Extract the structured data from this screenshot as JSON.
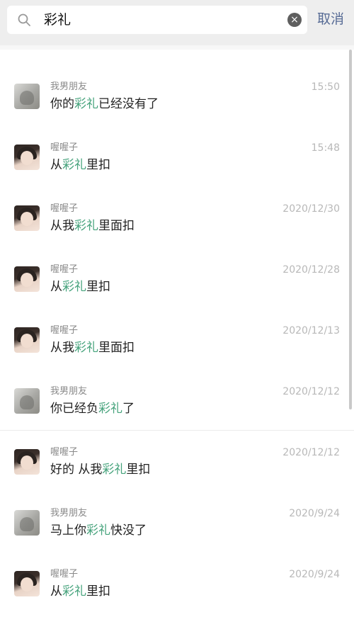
{
  "search": {
    "query": "彩礼",
    "cancel_label": "取消",
    "clear_icon": "×",
    "highlight_color": "#46a37c"
  },
  "results": [
    {
      "sender": "我男朋友",
      "time": "15:50",
      "avatar": "boy",
      "parts": [
        "你的",
        "彩礼",
        "已经没有了"
      ]
    },
    {
      "sender": "喔喔子",
      "time": "15:48",
      "avatar": "girl",
      "parts": [
        "从",
        "彩礼",
        "里扣"
      ]
    },
    {
      "sender": "喔喔子",
      "time": "2020/12/30",
      "avatar": "girl",
      "parts": [
        "从我",
        "彩礼",
        "里面扣"
      ]
    },
    {
      "sender": "喔喔子",
      "time": "2020/12/28",
      "avatar": "girl",
      "parts": [
        "从",
        "彩礼",
        "里扣"
      ]
    },
    {
      "sender": "喔喔子",
      "time": "2020/12/13",
      "avatar": "girl",
      "parts": [
        "从我",
        "彩礼",
        "里面扣"
      ]
    },
    {
      "sender": "我男朋友",
      "time": "2020/12/12",
      "avatar": "boy",
      "parts": [
        "你已经负",
        "彩礼",
        "了"
      ]
    },
    {
      "sender": "喔喔子",
      "time": "2020/12/12",
      "avatar": "girl",
      "parts": [
        "好的 从我",
        "彩礼",
        "里扣"
      ]
    },
    {
      "sender": "我男朋友",
      "time": "2020/9/24",
      "avatar": "boy",
      "parts": [
        "马上你",
        "彩礼",
        "快没了"
      ]
    },
    {
      "sender": "喔喔子",
      "time": "2020/9/24",
      "avatar": "girl",
      "parts": [
        "从",
        "彩礼",
        "里扣"
      ]
    }
  ]
}
